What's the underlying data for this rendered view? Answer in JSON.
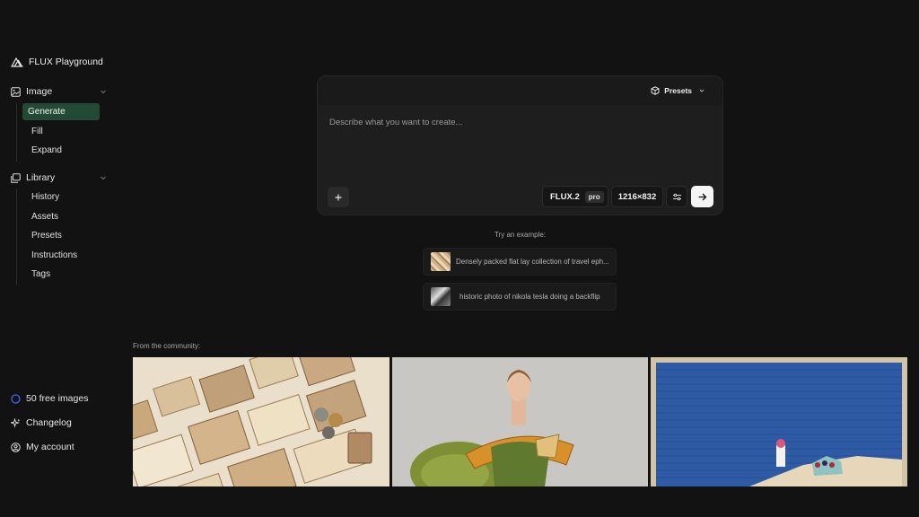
{
  "app": {
    "title": "FLUX Playground"
  },
  "sidebar": {
    "image_section": {
      "label": "Image",
      "items": [
        "Generate",
        "Fill",
        "Expand"
      ]
    },
    "library_section": {
      "label": "Library",
      "items": [
        "History",
        "Assets",
        "Presets",
        "Instructions",
        "Tags"
      ]
    },
    "bottom": {
      "free_images": "50 free images",
      "changelog": "Changelog",
      "account": "My account"
    }
  },
  "prompt": {
    "presets_label": "Presets",
    "placeholder": "Describe what you want to create...",
    "model": "FLUX.2",
    "model_badge": "pro",
    "size": "1216×832"
  },
  "examples": {
    "label": "Try an example:",
    "items": [
      "Densely packed flat lay collection of travel eph...",
      "historic photo of nikola tesla doing a backflip"
    ]
  },
  "community": {
    "label": "From the community:"
  },
  "colors": {
    "background": "#121212",
    "accent_active": "#234a35",
    "free_images_ring": "#3b6cff"
  }
}
